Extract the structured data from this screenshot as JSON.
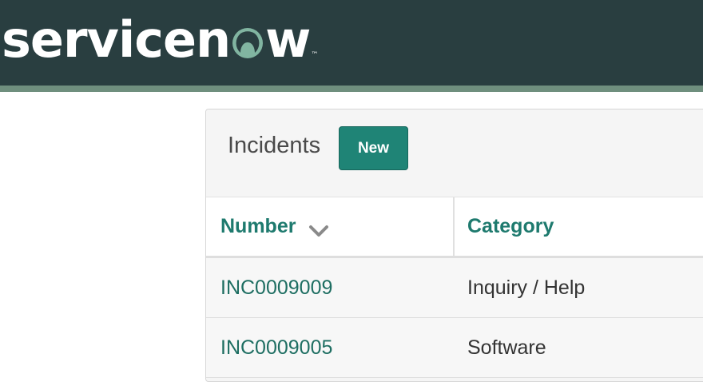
{
  "header": {
    "logo_text_part1": "servicen",
    "logo_text_part2": "w",
    "logo_tm": "™",
    "colors": {
      "bar": "#293e40",
      "stripe": "#6f8f7e",
      "logo_o": "#81b5a1"
    }
  },
  "panel": {
    "title": "Incidents",
    "new_button_label": "New",
    "accent_color": "#1f8476"
  },
  "table": {
    "columns": [
      {
        "label": "Number",
        "sort_icon": "chevron-down-icon"
      },
      {
        "label": "Category"
      }
    ],
    "rows": [
      {
        "number": "INC0009009",
        "category": "Inquiry / Help"
      },
      {
        "number": "INC0009005",
        "category": "Software"
      }
    ]
  }
}
